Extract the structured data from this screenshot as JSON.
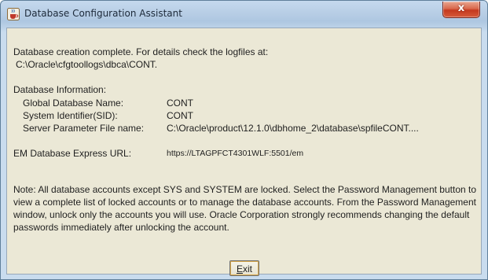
{
  "window": {
    "title": "Database Configuration Assistant",
    "close_label": "x"
  },
  "message": {
    "line1": "Database creation complete. For details check the logfiles at:",
    "line2": "C:\\Oracle\\cfgtoollogs\\dbca\\CONT."
  },
  "database_info": {
    "heading": "Database Information:",
    "rows": [
      {
        "label": "Global Database Name:",
        "value": "CONT"
      },
      {
        "label": "System Identifier(SID):",
        "value": "CONT"
      },
      {
        "label": "Server Parameter File name:",
        "value": "C:\\Oracle\\product\\12.1.0\\dbhome_2\\database\\spfileCONT...."
      }
    ]
  },
  "em": {
    "label": "EM Database Express URL:",
    "url": "https://LTAGPFCT4301WLF:5501/em"
  },
  "note": "Note: All database accounts except SYS and SYSTEM are locked. Select the Password Management button to view a complete list of locked accounts or to manage the database accounts. From the Password Management window, unlock only the accounts you will use. Oracle Corporation strongly recommends changing the default passwords immediately after unlocking the account.",
  "buttons": {
    "exit_mnemonic": "E",
    "exit_rest": "xit"
  },
  "icons": {
    "app": "java-cup-icon",
    "close": "close-icon"
  },
  "colors": {
    "close_button": "#c4391f",
    "dialog_background": "#ebe8d6",
    "titlebar": "#b9cfe6"
  }
}
